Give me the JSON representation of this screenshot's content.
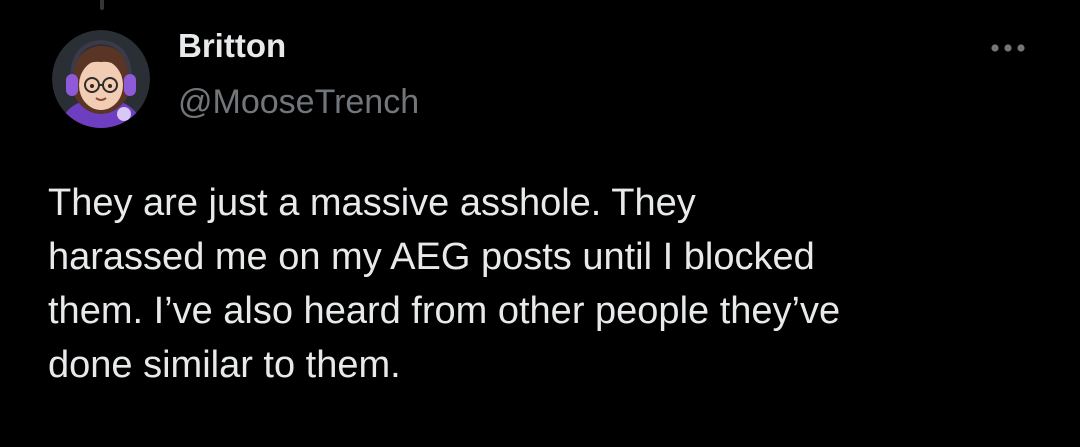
{
  "colors": {
    "background": "#000000",
    "primary_text": "#e7e9ea",
    "secondary_text": "#71767b",
    "thread_line": "#333639"
  },
  "tweet": {
    "author": {
      "display_name": "Britton",
      "handle": "@MooseTrench",
      "avatar_icon": "cartoon-avatar-with-headphones"
    },
    "more_icon": "more-horizontal-icon",
    "text_lines": [
      "They are just a massive asshole. They",
      "harassed me on my AEG posts until I blocked",
      "them. I’ve also heard from other people they’ve",
      "done similar to them."
    ]
  }
}
